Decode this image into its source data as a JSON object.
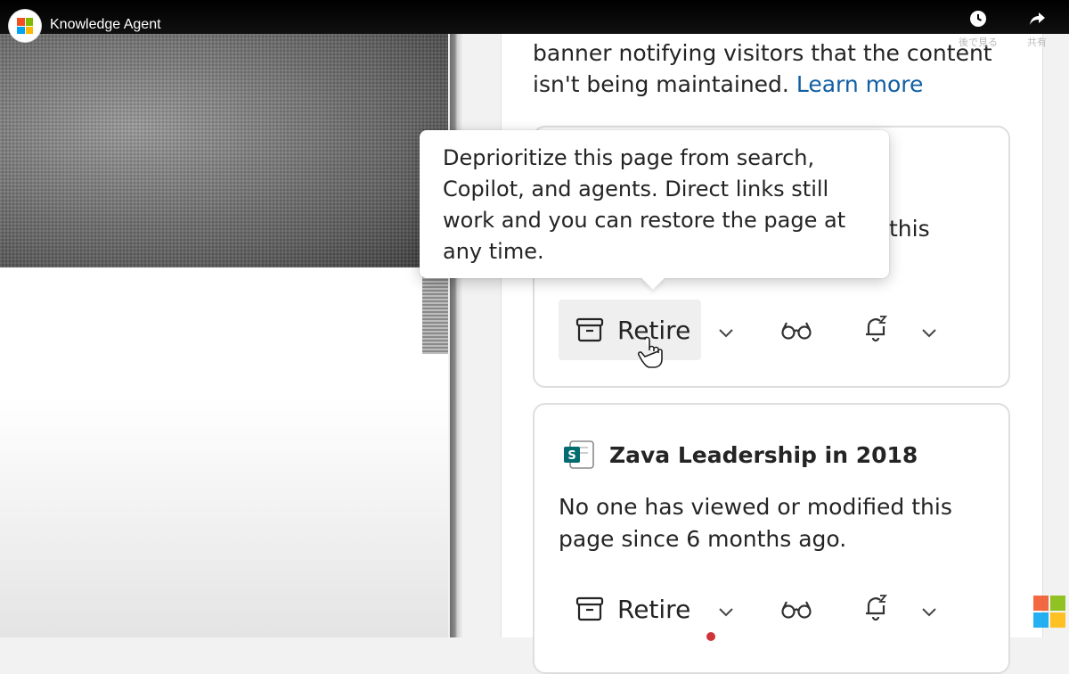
{
  "video": {
    "title": "Knowledge Agent",
    "watch_later_label": "後で見る",
    "share_label": "共有"
  },
  "panel": {
    "intro_text": "banner notifying visitors that the content isn't being maintained.",
    "learn_more_label": "Learn more"
  },
  "card1": {
    "partial_text": "this",
    "retire_label": "Retire"
  },
  "tooltip": {
    "text": "Deprioritize this page from search, Copilot, and agents. Direct links still work and you can restore the page at any time."
  },
  "card2": {
    "title": "Zava Leadership in 2018",
    "description": "No one has viewed or modified this page since 6 months ago.",
    "retire_label": "Retire"
  },
  "icons": {
    "archive": "archive-icon",
    "review": "glasses-icon",
    "snooze": "snooze-bell-icon",
    "chevron": "chevron-down-icon",
    "sharepoint": "sharepoint-file-icon"
  },
  "colors": {
    "link": "#115ea3",
    "sharepoint_teal": "#036c70",
    "ms_red": "#f25022",
    "ms_green": "#7fba00",
    "ms_blue": "#00a4ef",
    "ms_yellow": "#ffb900"
  }
}
